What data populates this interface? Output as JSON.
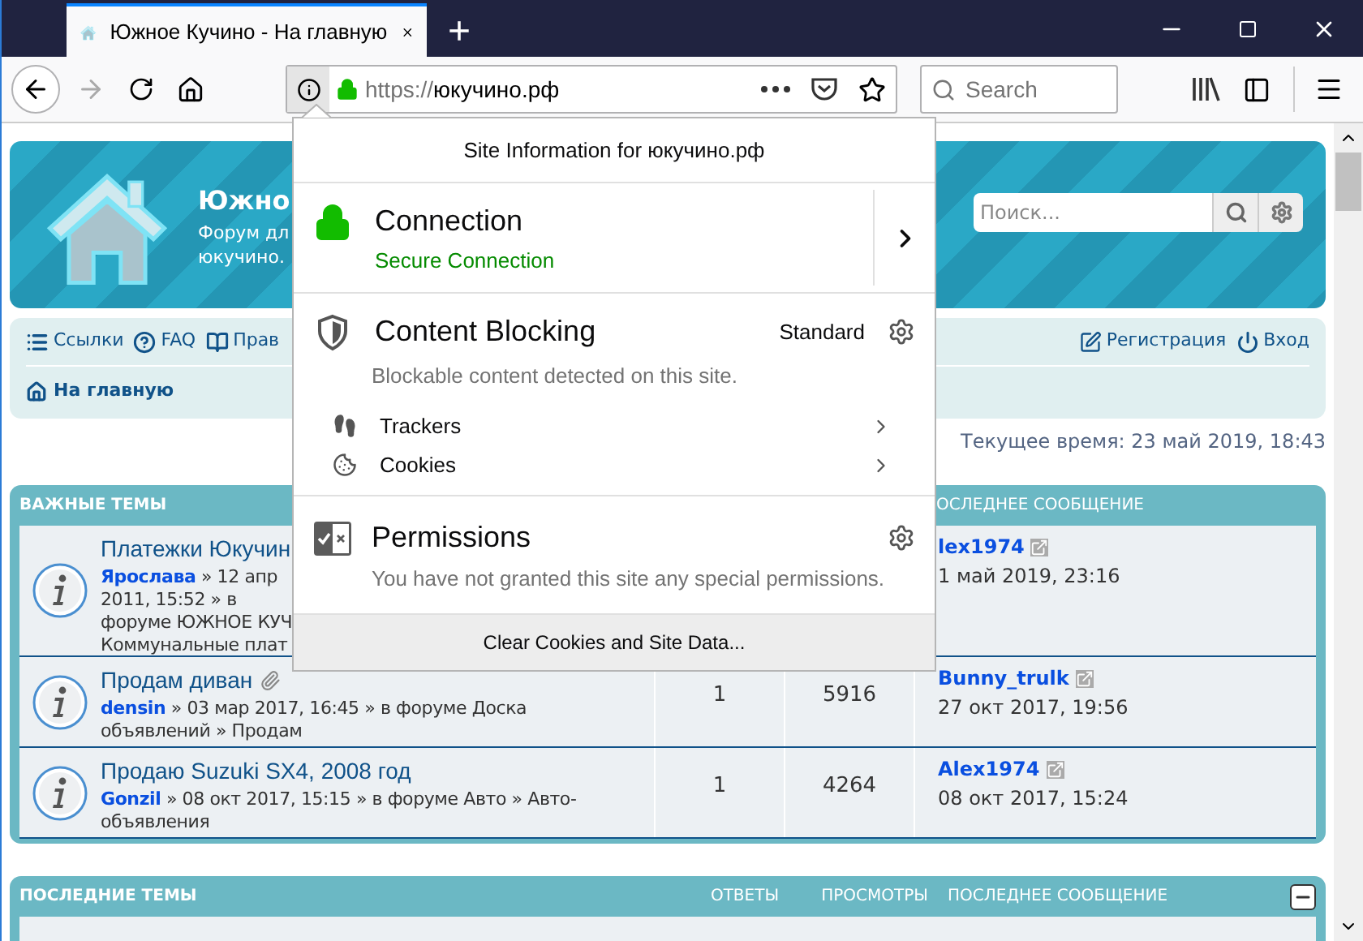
{
  "browser": {
    "tab": {
      "title": "Южное Кучино - На главную",
      "selected": true
    },
    "new_tab": "+",
    "url": {
      "scheme": "https://",
      "host": "юкучино.рф"
    },
    "search_placeholder": "Search"
  },
  "page": {
    "header": {
      "title": "Южно",
      "subtitle_lines": [
        "Форум дл",
        "юкучино."
      ],
      "search_placeholder": "Поиск..."
    },
    "nav_links": [
      {
        "label": "Ссылки",
        "kind": "links"
      },
      {
        "label": "FAQ",
        "kind": "faq"
      },
      {
        "label": "Прав",
        "kind": "rules"
      }
    ],
    "user_links": [
      {
        "label": "Регистрация",
        "kind": "register"
      },
      {
        "label": "Вход",
        "kind": "login"
      }
    ],
    "breadcrumb": "На главную",
    "current_time": "Текущее время: 23 май 2019, 18:43",
    "sticky": {
      "title": "ВАЖНЫЕ ТЕМЫ",
      "last_post_column": "ОСЛЕДНЕЕ СООБЩЕНИЕ",
      "rows": [
        {
          "title": "Платежки Юкучин",
          "author": "Ярослава",
          "lines": [
            "» 12 апр",
            "2011, 15:52 » в",
            "форуме ЮЖНОЕ КУЧ",
            "Коммунальные плат"
          ],
          "last_author": "lex1974",
          "last_date": "1 май 2019, 23:16"
        },
        {
          "title": "Продам диван",
          "attachment": true,
          "author": "densin",
          "lines": [
            "» 03 мар 2017, 16:45 » в форуме Доска",
            "объявлений » Продам"
          ],
          "replies": "1",
          "views": "5916",
          "last_author": "Bunny_trulk",
          "last_date": "27 окт 2017, 19:56"
        },
        {
          "title": "Продаю Suzuki SX4, 2008 год",
          "attachment": false,
          "author": "Gonzil",
          "lines": [
            "» 08 окт 2017, 15:15 » в форуме Авто » Авто-",
            "объявления"
          ],
          "replies": "1",
          "views": "4264",
          "last_author": "Alex1974",
          "last_date": "08 окт 2017, 15:24"
        }
      ]
    },
    "recent": {
      "title": "ПОСЛЕДНИЕ ТЕМЫ",
      "columns": [
        "ОТВЕТЫ",
        "ПРОСМОТРЫ",
        "ПОСЛЕДНЕЕ СООБЩЕНИЕ"
      ],
      "expanded": true
    }
  },
  "popup": {
    "title": "Site Information for юкучино.рф",
    "connection": {
      "heading": "Connection",
      "status": "Secure Connection",
      "secure": true
    },
    "content_blocking": {
      "heading": "Content Blocking",
      "mode": "Standard",
      "description": "Blockable content detected on this site.",
      "items": [
        {
          "label": "Trackers",
          "kind": "trackers"
        },
        {
          "label": "Cookies",
          "kind": "cookies"
        }
      ]
    },
    "permissions": {
      "heading": "Permissions",
      "description": "You have not granted this site any special permissions."
    },
    "footer_button": "Clear Cookies and Site Data..."
  }
}
